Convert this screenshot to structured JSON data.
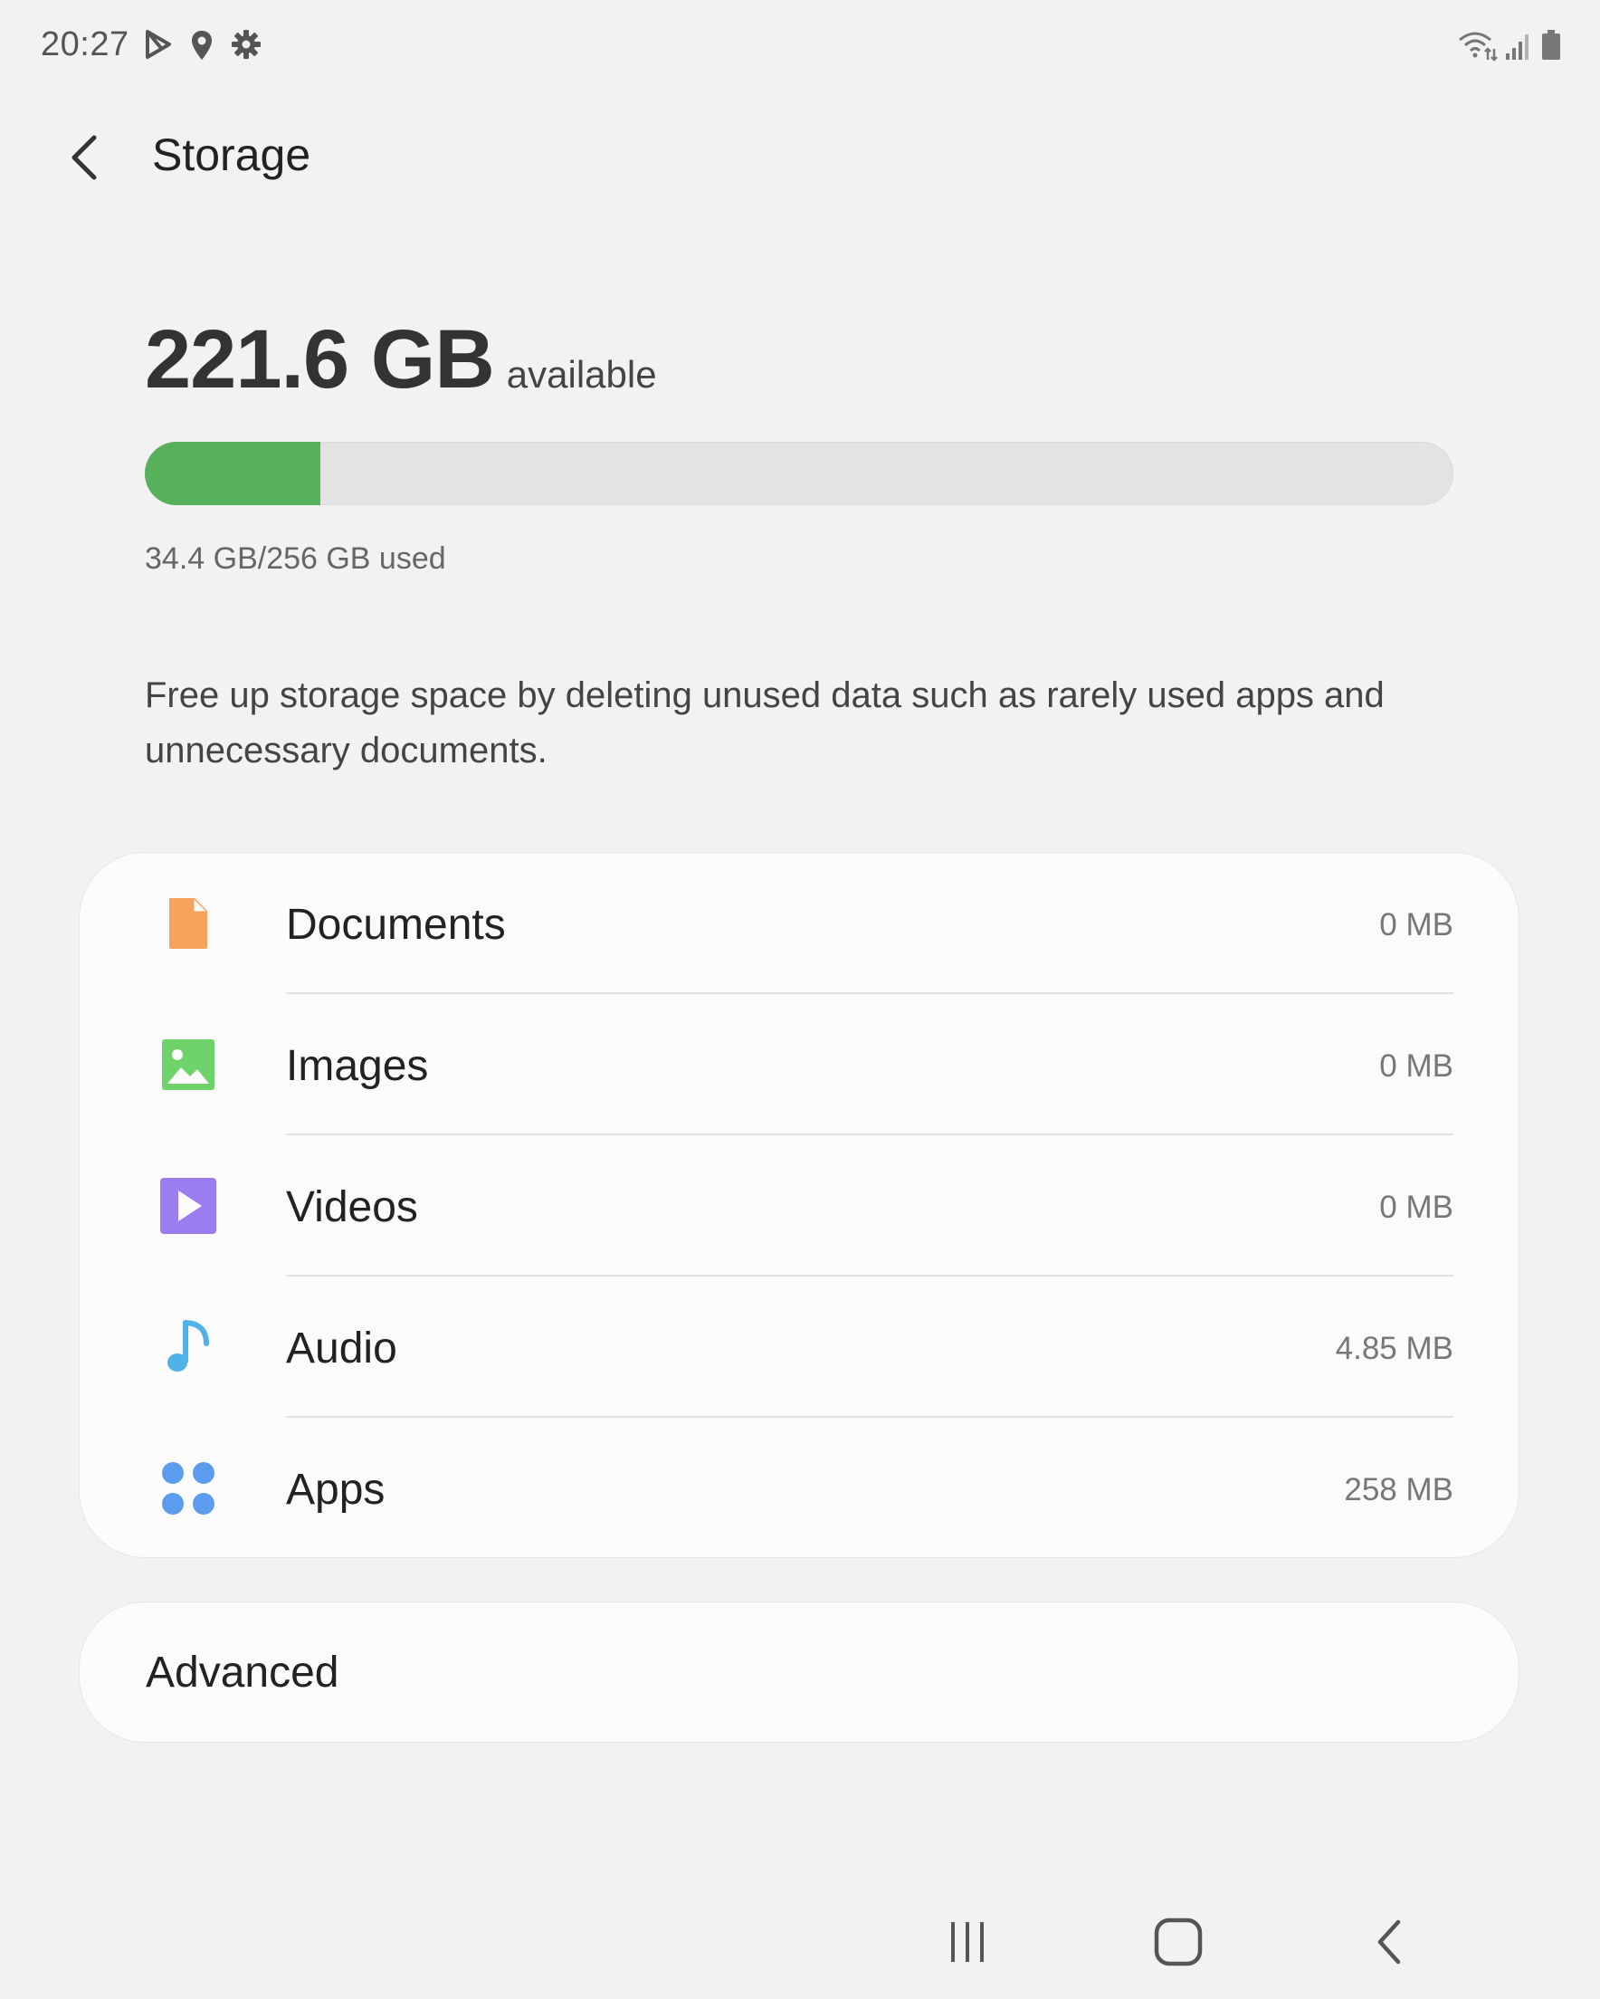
{
  "status_bar": {
    "time": "20:27",
    "left_icons": [
      "play-store-notification-icon",
      "location-icon",
      "settings-gear-icon"
    ],
    "right_icons": [
      "wifi-icon",
      "cellular-signal-icon",
      "battery-icon"
    ]
  },
  "app_bar": {
    "title": "Storage",
    "back_icon": "back-arrow-icon"
  },
  "storage": {
    "available_amount": "221.6 GB",
    "available_label": "available",
    "used_text": "34.4 GB/256 GB used",
    "used_fraction": 0.134,
    "bar_color": "#57b05a"
  },
  "description": "Free up storage space by deleting unused data such as rarely used apps and unnecessary documents.",
  "categories": [
    {
      "label": "Documents",
      "size": "0 MB",
      "icon": "document-icon",
      "color": "#f5a25d"
    },
    {
      "label": "Images",
      "size": "0 MB",
      "icon": "image-icon",
      "color": "#6ed36b"
    },
    {
      "label": "Videos",
      "size": "0 MB",
      "icon": "video-icon",
      "color": "#9b7df0"
    },
    {
      "label": "Audio",
      "size": "4.85 MB",
      "icon": "music-note-icon",
      "color": "#4fb3ea"
    },
    {
      "label": "Apps",
      "size": "258 MB",
      "icon": "apps-grid-icon",
      "color": "#5b9cee"
    }
  ],
  "advanced": {
    "label": "Advanced"
  },
  "nav_bar": {
    "icons": [
      "recent-apps-icon",
      "home-icon",
      "back-icon"
    ]
  }
}
